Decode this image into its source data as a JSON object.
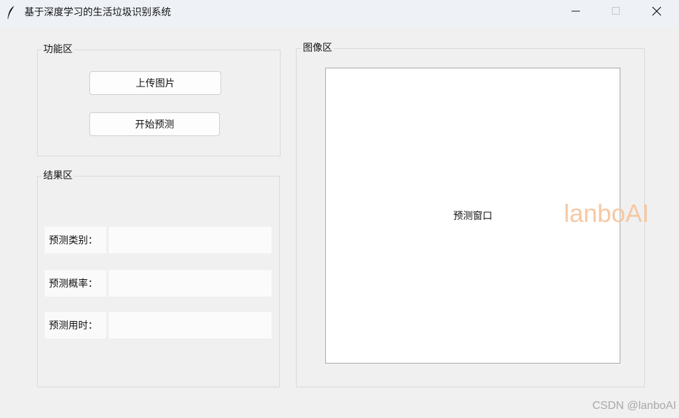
{
  "window": {
    "title": "基于深度学习的生活垃圾识别系统",
    "app_icon": "feather-icon",
    "controls": [
      "minimize-icon",
      "maximize-icon",
      "close-icon"
    ]
  },
  "function_panel": {
    "legend": "功能区",
    "upload_label": "上传图片",
    "predict_label": "开始预测"
  },
  "result_panel": {
    "legend": "结果区",
    "rows": [
      {
        "label": "预测类别：",
        "value": ""
      },
      {
        "label": "预测概率：",
        "value": ""
      },
      {
        "label": "预测用时：",
        "value": ""
      }
    ]
  },
  "image_panel": {
    "legend": "图像区",
    "canvas_text": "预测窗口"
  },
  "watermarks": {
    "brand": "lanboAI",
    "csdn": "CSDN @lanboAI"
  },
  "colors": {
    "background": "#f0f0f0",
    "titlebar": "#eef2f7",
    "brand_watermark": "#f5c8a4"
  }
}
